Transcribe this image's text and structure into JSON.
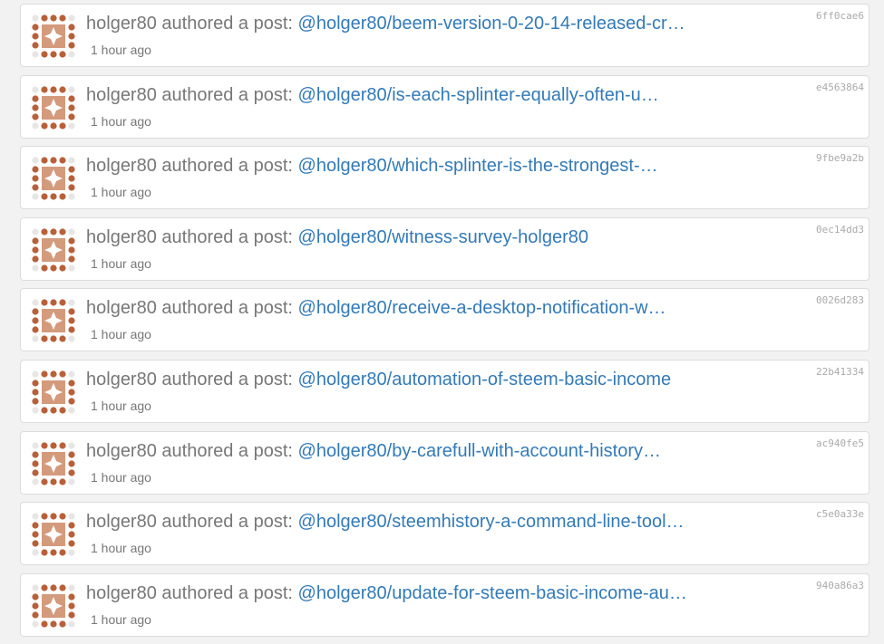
{
  "feed": {
    "items": [
      {
        "author": "holger80",
        "action": " authored a post: ",
        "link": "@holger80/beem-version-0-20-14-released-cr…",
        "time": "1 hour ago",
        "hash": "6ff0cae6"
      },
      {
        "author": "holger80",
        "action": " authored a post: ",
        "link": "@holger80/is-each-splinter-equally-often-u…",
        "time": "1 hour ago",
        "hash": "e4563864"
      },
      {
        "author": "holger80",
        "action": " authored a post: ",
        "link": "@holger80/which-splinter-is-the-strongest-…",
        "time": "1 hour ago",
        "hash": "9fbe9a2b"
      },
      {
        "author": "holger80",
        "action": " authored a post: ",
        "link": "@holger80/witness-survey-holger80",
        "time": "1 hour ago",
        "hash": "0ec14dd3"
      },
      {
        "author": "holger80",
        "action": " authored a post: ",
        "link": "@holger80/receive-a-desktop-notification-w…",
        "time": "1 hour ago",
        "hash": "0026d283"
      },
      {
        "author": "holger80",
        "action": " authored a post: ",
        "link": "@holger80/automation-of-steem-basic-income",
        "time": "1 hour ago",
        "hash": "22b41334"
      },
      {
        "author": "holger80",
        "action": " authored a post: ",
        "link": "@holger80/by-carefull-with-account-history…",
        "time": "1 hour ago",
        "hash": "ac940fe5"
      },
      {
        "author": "holger80",
        "action": " authored a post: ",
        "link": "@holger80/steemhistory-a-command-line-tool…",
        "time": "1 hour ago",
        "hash": "c5e0a33e"
      },
      {
        "author": "holger80",
        "action": " authored a post: ",
        "link": "@holger80/update-for-steem-basic-income-au…",
        "time": "1 hour ago",
        "hash": "940a86a3"
      }
    ]
  },
  "colors": {
    "avatar_primary": "#d49a7c",
    "avatar_dark": "#b8603a",
    "avatar_light": "#e6e6e6",
    "link": "#337ab7",
    "muted": "#777777"
  },
  "icons": {
    "avatar": "identicon-avatar"
  }
}
